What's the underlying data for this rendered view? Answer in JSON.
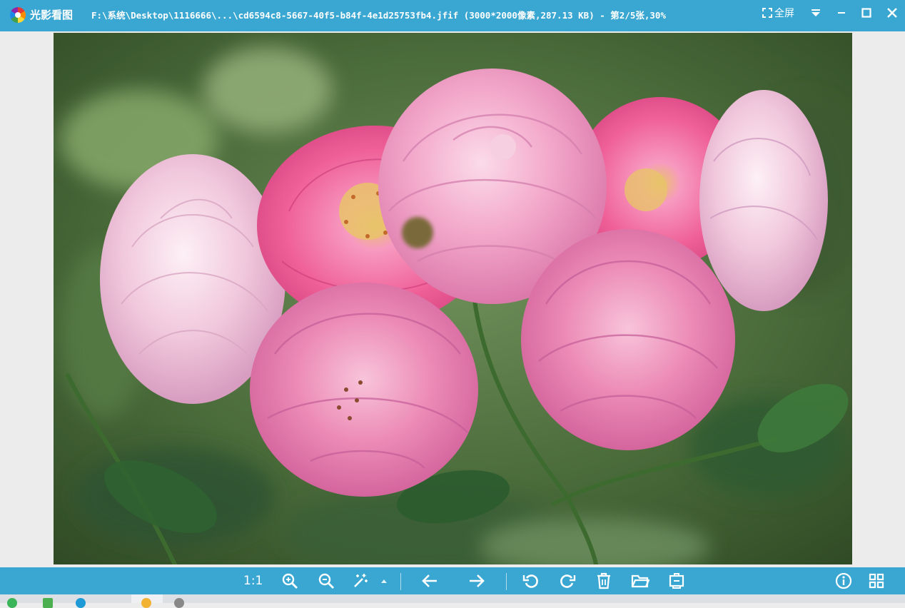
{
  "titlebar": {
    "app_name": "光影看图",
    "file_info": "F:\\系统\\Desktop\\1116666\\...\\cd6594c8-5667-40f5-b84f-4e1d25753fb4.jfif (3000*2000像素,287.13 KB) - 第2/5张,30%",
    "fullscreen_label": "全屏",
    "icons": [
      "app-logo",
      "fullscreen-icon",
      "dropdown-icon",
      "minimize-icon",
      "maximize-icon",
      "close-icon"
    ]
  },
  "viewer": {
    "image_description_colors": {
      "background_green": "#4a6b3a",
      "rose_pink": "#f07aa8",
      "light_pink": "#f3c6d8"
    }
  },
  "toolbar": {
    "actual_size_label": "1:1",
    "icons": [
      "zoom-in-icon",
      "zoom-out-icon",
      "magic-wand-icon",
      "triangle-up-icon",
      "arrow-left-icon",
      "arrow-right-icon",
      "rotate-left-icon",
      "rotate-right-icon",
      "trash-icon",
      "folder-icon",
      "stamp-icon",
      "info-icon",
      "grid-icon"
    ]
  },
  "colors": {
    "accent": "#3aa7d2",
    "viewport_bg": "#ececec"
  }
}
